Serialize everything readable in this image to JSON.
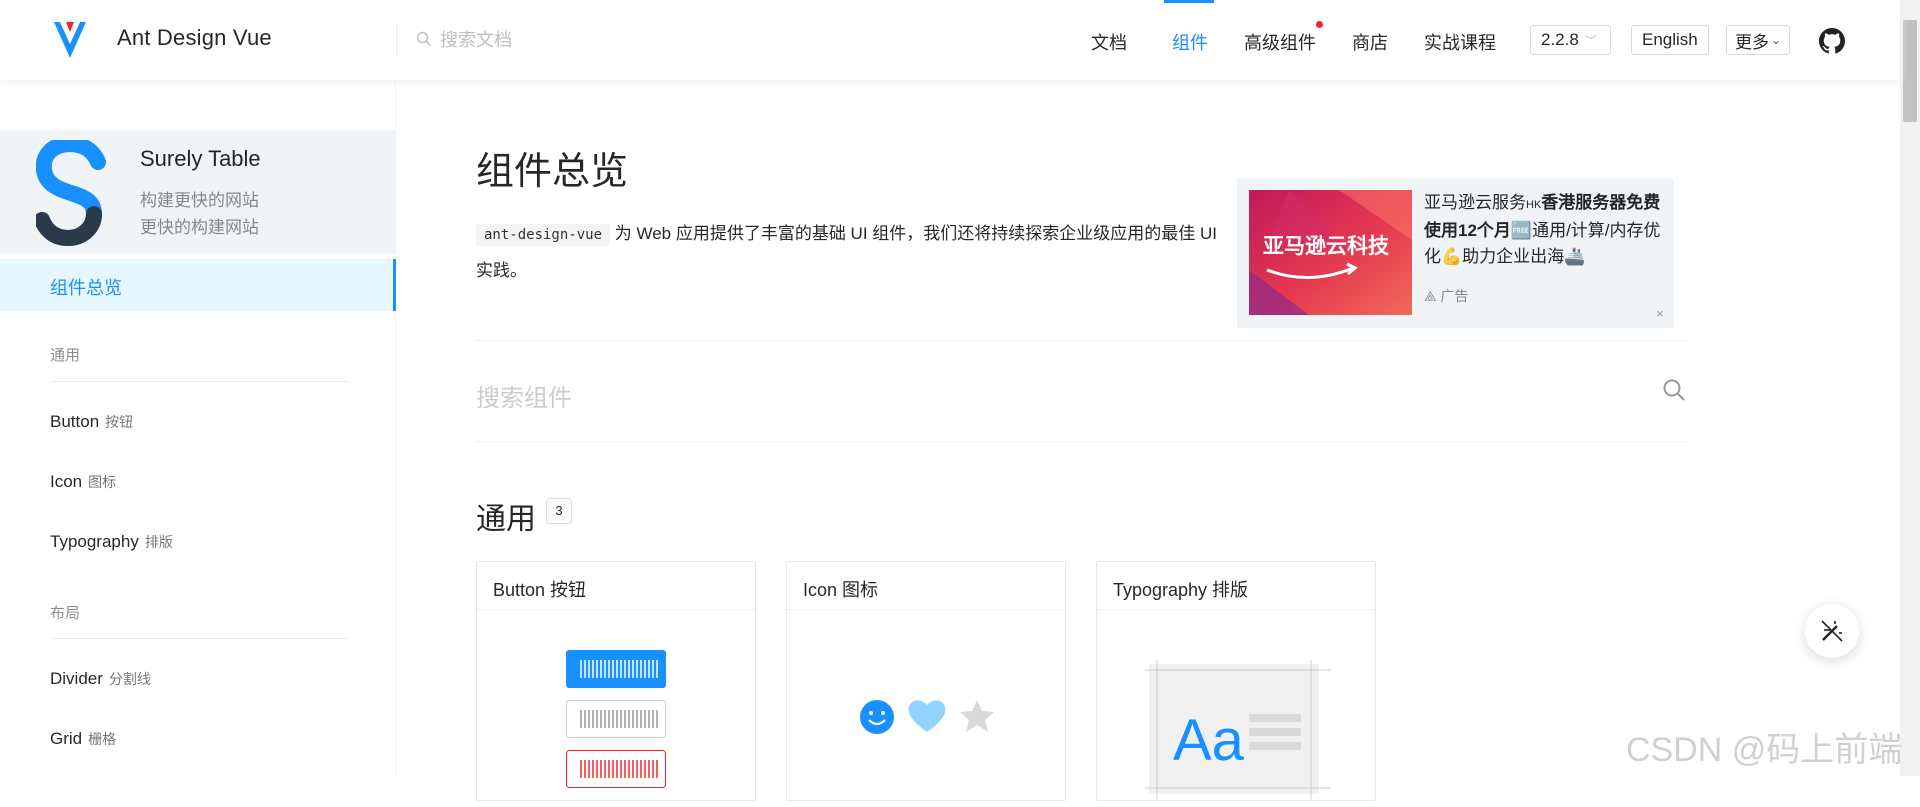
{
  "header": {
    "brand": "Ant Design Vue",
    "search_placeholder": "搜索文档",
    "nav": [
      {
        "label": "文档"
      },
      {
        "label": "组件",
        "active": true
      },
      {
        "label": "高级组件",
        "has_dot": true
      },
      {
        "label": "商店"
      },
      {
        "label": "实战课程"
      }
    ],
    "version": "2.2.8",
    "language": "English",
    "more": "更多",
    "github_icon": "github-icon"
  },
  "sidebar": {
    "promo": {
      "title": "Surely Table",
      "sub1": "构建更快的网站",
      "sub2": "更快的构建网站"
    },
    "active_item": "组件总览",
    "groups": [
      {
        "title": "通用",
        "items": [
          {
            "en": "Button",
            "cn": "按钮"
          },
          {
            "en": "Icon",
            "cn": "图标"
          },
          {
            "en": "Typography",
            "cn": "排版"
          }
        ]
      },
      {
        "title": "布局",
        "items": [
          {
            "en": "Divider",
            "cn": "分割线"
          },
          {
            "en": "Grid",
            "cn": "栅格"
          }
        ]
      }
    ]
  },
  "main": {
    "title": "组件总览",
    "intro_code": "ant-design-vue",
    "intro_text": " 为 Web 应用提供了丰富的基础 UI 组件，我们还将持续探索企业级应用的最佳 UI 实践。",
    "ad": {
      "image_text": "亚马逊云科技",
      "text_plain1": "亚马逊云服务",
      "text_small": "HK",
      "text_bold": "香港服务器免费使用12个月",
      "text_plain2": "🆓通用/计算/内存优化💪助力企业出海🚢",
      "label": "广告",
      "close": "×"
    },
    "component_search_placeholder": "搜索组件",
    "section": {
      "title": "通用",
      "count": "3"
    },
    "cards": [
      {
        "title": "Button 按钮"
      },
      {
        "title": "Icon 图标"
      },
      {
        "title": "Typography 排版"
      }
    ]
  },
  "watermark": "CSDN @码上前端",
  "colors": {
    "primary": "#1890ff",
    "active_bg": "#e6f7ff",
    "dot": "#f5222d"
  }
}
